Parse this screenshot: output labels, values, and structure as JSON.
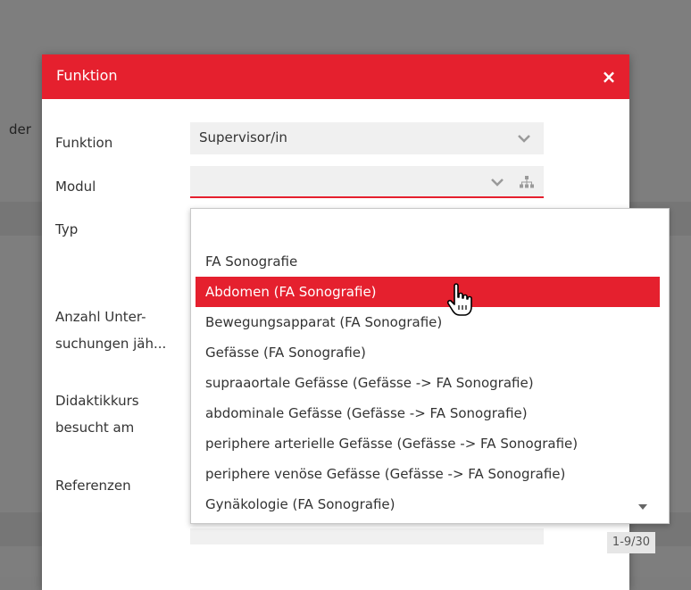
{
  "background": {
    "partial_label": "der"
  },
  "dialog": {
    "title": "Funktion",
    "close_label": "×",
    "accent_color": "#e5202e"
  },
  "form": {
    "funktion_label": "Funktion",
    "funktion_value": "Supervisor/in",
    "modul_label": "Modul",
    "modul_value": "",
    "typ_label": "Typ",
    "anzahl_label_line1": "Anzahl Unter-",
    "anzahl_label_line2": "suchungen jäh...",
    "didaktik_label_line1": "Didaktikkurs",
    "didaktik_label_line2": "besucht am",
    "referenzen_label": "Referenzen"
  },
  "dropdown": {
    "options": [
      "FA Sonografie",
      "Abdomen (FA Sonografie)",
      "Bewegungsapparat (FA Sonografie)",
      "Gefässe (FA Sonografie)",
      "supraaortale Gefässe (Gefässe -> FA Sonografie)",
      "abdominale Gefässe (Gefässe -> FA Sonografie)",
      "periphere arterielle Gefässe (Gefässe -> FA Sonografie)",
      "periphere venöse Gefässe (Gefässe -> FA Sonografie)",
      "Gynäkologie (FA Sonografie)"
    ],
    "highlighted_index": 1,
    "pager": "1-9/30"
  },
  "icons": {
    "chevron": "chevron-down-icon",
    "org": "org-chart-icon",
    "close": "close-icon",
    "scroll": "scroll-down-arrow-icon",
    "cursor": "hand-pointer-cursor-icon"
  }
}
